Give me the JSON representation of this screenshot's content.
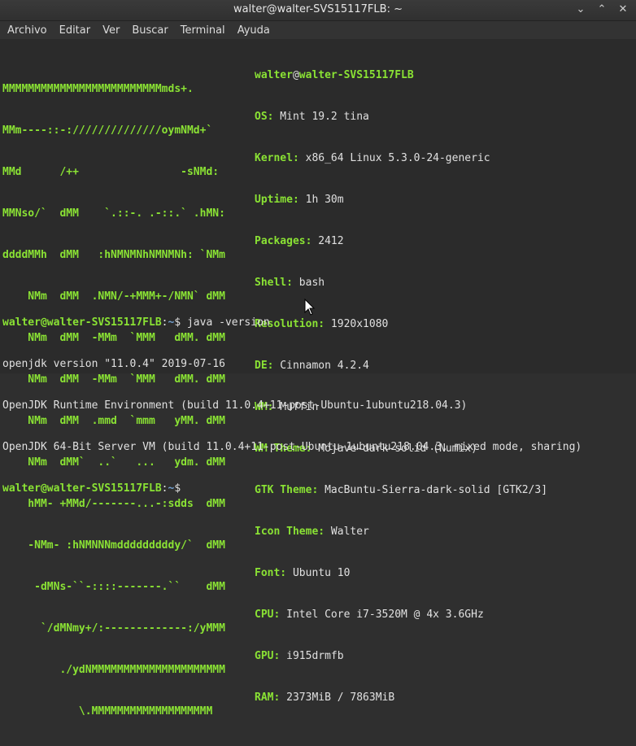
{
  "window": {
    "title": "walter@walter-SVS15117FLB: ~",
    "minimize": "⌄",
    "maximize": "⌃",
    "close": "✕"
  },
  "menu": [
    "Archivo",
    "Editar",
    "Ver",
    "Buscar",
    "Terminal",
    "Ayuda"
  ],
  "logo": [
    "MMMMMMMMMMMMMMMMMMMMMMMMMmds+.",
    "MMm----::-://////////////oymNMd+`",
    "MMd      /++                -sNMd:",
    "MMNso/`  dMM    `.::-. .-::.` .hMN:",
    "ddddMMh  dMM   :hNMNMNhNMNMNh: `NMm",
    "    NMm  dMM  .NMN/-+MMM+-/NMN` dMM",
    "    NMm  dMM  -MMm  `MMM   dMM. dMM",
    "    NMm  dMM  -MMm  `MMM   dMM. dMM",
    "    NMm  dMM  .mmd  `mmm   yMM. dMM",
    "    NMm  dMM`  ..`   ...   ydm. dMM",
    "    hMM- +MMd/-------...-:sdds  dMM",
    "    -NMm- :hNMNNNmdddddddddy/`  dMM",
    "     -dMNs-``-::::-------.``    dMM",
    "      `/dMNmy+/:-------------:/yMMM",
    "         ./ydNMMMMMMMMMMMMMMMMMMMMM",
    "            \\.MMMMMMMMMMMMMMMMMMM"
  ],
  "info": {
    "user": "walter",
    "at": "@",
    "host": "walter-SVS15117FLB",
    "rows": [
      {
        "key": "OS:",
        "value": " Mint 19.2 tina"
      },
      {
        "key": "Kernel:",
        "value": " x86_64 Linux 5.3.0-24-generic"
      },
      {
        "key": "Uptime:",
        "value": " 1h 30m"
      },
      {
        "key": "Packages:",
        "value": " 2412"
      },
      {
        "key": "Shell:",
        "value": " bash"
      },
      {
        "key": "Resolution:",
        "value": " 1920x1080"
      },
      {
        "key": "DE:",
        "value": " Cinnamon 4.2.4"
      },
      {
        "key": "WM:",
        "value": " Muffin"
      },
      {
        "key": "WM Theme:",
        "value": " Mojave-dark-solid (Numix)"
      },
      {
        "key": "GTK Theme:",
        "value": " MacBuntu-Sierra-dark-solid [GTK2/3]"
      },
      {
        "key": "Icon Theme:",
        "value": " Walter"
      },
      {
        "key": "Font:",
        "value": " Ubuntu 10"
      },
      {
        "key": "CPU:",
        "value": " Intel Core i7-3520M @ 4x 3.6GHz"
      },
      {
        "key": "GPU:",
        "value": " i915drmfb"
      },
      {
        "key": "RAM:",
        "value": " 2373MiB / 7863MiB"
      }
    ]
  },
  "session": {
    "prompt_user": "walter@walter-SVS15117FLB",
    "prompt_sep": ":",
    "prompt_path": "~",
    "prompt_end": "$ ",
    "command": "java -version",
    "output": [
      "openjdk version \"11.0.4\" 2019-07-16",
      "OpenJDK Runtime Environment (build 11.0.4+11-post-Ubuntu-1ubuntu218.04.3)",
      "OpenJDK 64-Bit Server VM (build 11.0.4+11-post-Ubuntu-1ubuntu218.04.3, mixed mode, sharing)"
    ]
  },
  "colors": {
    "green": "#8ae234",
    "blue": "#729fcf",
    "text": "#d8d8d8",
    "background": "#2b2b2b"
  }
}
